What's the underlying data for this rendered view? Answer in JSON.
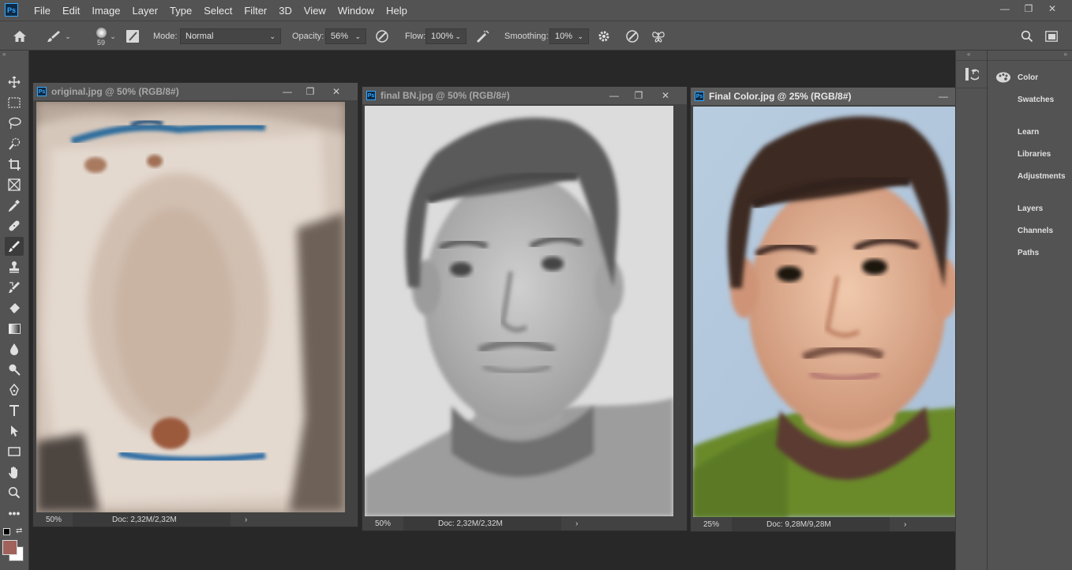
{
  "app": {
    "logo": "Ps"
  },
  "menu": [
    "File",
    "Edit",
    "Image",
    "Layer",
    "Type",
    "Select",
    "Filter",
    "3D",
    "View",
    "Window",
    "Help"
  ],
  "window_controls": {
    "minimize": "—",
    "restore": "❐",
    "close": "✕"
  },
  "options": {
    "brush_size": "59",
    "mode_label": "Mode:",
    "mode_value": "Normal",
    "opacity_label": "Opacity:",
    "opacity_value": "56%",
    "flow_label": "Flow:",
    "flow_value": "100%",
    "smoothing_label": "Smoothing:",
    "smoothing_value": "10%"
  },
  "panels": [
    "Color",
    "Swatches",
    "Learn",
    "Libraries",
    "Adjustments",
    "Layers",
    "Channels",
    "Paths"
  ],
  "documents": [
    {
      "title": "original.jpg @ 50% (RGB/8#)",
      "zoom": "50%",
      "doc": "Doc: 2,32M/2,32M",
      "arrow": "›"
    },
    {
      "title": "final BN.jpg @ 50% (RGB/8#)",
      "zoom": "50%",
      "doc": "Doc: 2,32M/2,32M",
      "arrow": "›"
    },
    {
      "title": "Final Color.jpg @ 25% (RGB/8#)",
      "zoom": "25%",
      "doc": "Doc: 9,28M/9,28M",
      "arrow": "›"
    }
  ],
  "colors": {
    "foreground": "#a0625a",
    "background": "#ffffff",
    "ui_bg": "#535353",
    "workspace": "#282828"
  },
  "icons": [
    "home-icon",
    "brush-icon",
    "move-icon",
    "marquee-icon",
    "lasso-icon",
    "quick-select-icon",
    "crop-icon",
    "frame-icon",
    "eyedropper-icon",
    "healing-icon",
    "brush-tool-icon",
    "stamp-icon",
    "history-brush-icon",
    "eraser-icon",
    "gradient-icon",
    "blur-icon",
    "dodge-icon",
    "pen-icon",
    "type-icon",
    "path-select-icon",
    "rectangle-icon",
    "hand-icon",
    "zoom-icon",
    "more-icon",
    "search-icon",
    "workspace-icon",
    "gear-icon"
  ]
}
